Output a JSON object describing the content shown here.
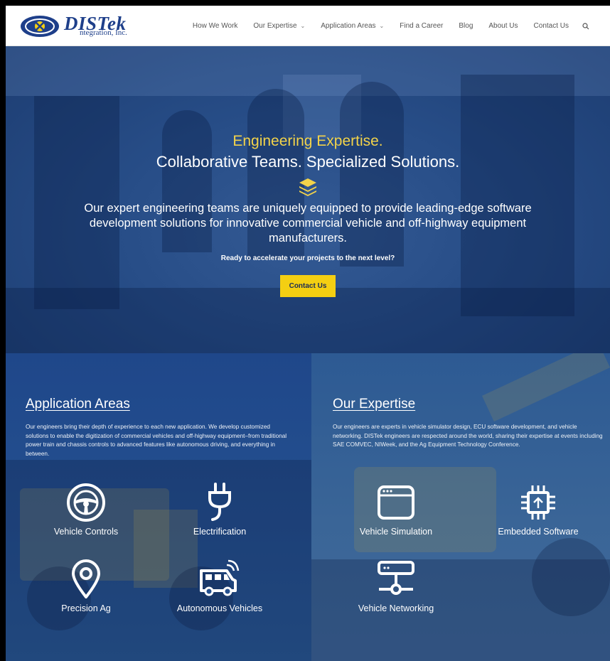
{
  "logo": {
    "name": "DISTek",
    "sub": "ntegration, Inc."
  },
  "nav": {
    "items": [
      {
        "label": "How We Work"
      },
      {
        "label": "Our Expertise",
        "dropdown": true
      },
      {
        "label": "Application Areas",
        "dropdown": true
      },
      {
        "label": "Find a Career"
      },
      {
        "label": "Blog"
      },
      {
        "label": "About Us"
      },
      {
        "label": "Contact Us"
      }
    ],
    "search_icon": "search-icon"
  },
  "hero": {
    "tagline": "Engineering Expertise.",
    "title": "Collaborative Teams. Specialized Solutions.",
    "icon": "layers-icon",
    "body": "Our expert engineering teams are uniquely equipped to provide leading-edge software development solutions for innovative commercial vehicle and off-highway equipment manufacturers.",
    "cta_text": "Ready to accelerate your projects to the next level?",
    "button": "Contact Us",
    "colors": {
      "accent": "#f4cf12",
      "tagline": "#f3d34a"
    }
  },
  "application_areas": {
    "title": "Application Areas",
    "description": "Our engineers bring their depth of experience to each new application. We develop customized solutions to enable the digitization of commercial vehicles and off-highway equipment–from traditional power train and chassis controls to advanced features like autonomous driving, and everything in between.",
    "items": [
      {
        "label": "Vehicle Controls",
        "icon": "steering-wheel-icon"
      },
      {
        "label": "Electrification",
        "icon": "plug-icon"
      },
      {
        "label": "Precision Ag",
        "icon": "map-pin-icon"
      },
      {
        "label": "Autonomous Vehicles",
        "icon": "autonomous-van-icon"
      }
    ]
  },
  "our_expertise": {
    "title": "Our Expertise",
    "description": "Our engineers are experts in vehicle simulator design, ECU software development, and vehicle networking. DISTek engineers are respected around the world, sharing their expertise at events including SAE COMVEC, NIWeek, and the Ag Equipment Technology Conference.",
    "items": [
      {
        "label": "Vehicle Simulation",
        "icon": "browser-window-icon"
      },
      {
        "label": "Embedded Software",
        "icon": "chip-icon"
      },
      {
        "label": "Vehicle Networking",
        "icon": "network-server-icon"
      }
    ]
  }
}
